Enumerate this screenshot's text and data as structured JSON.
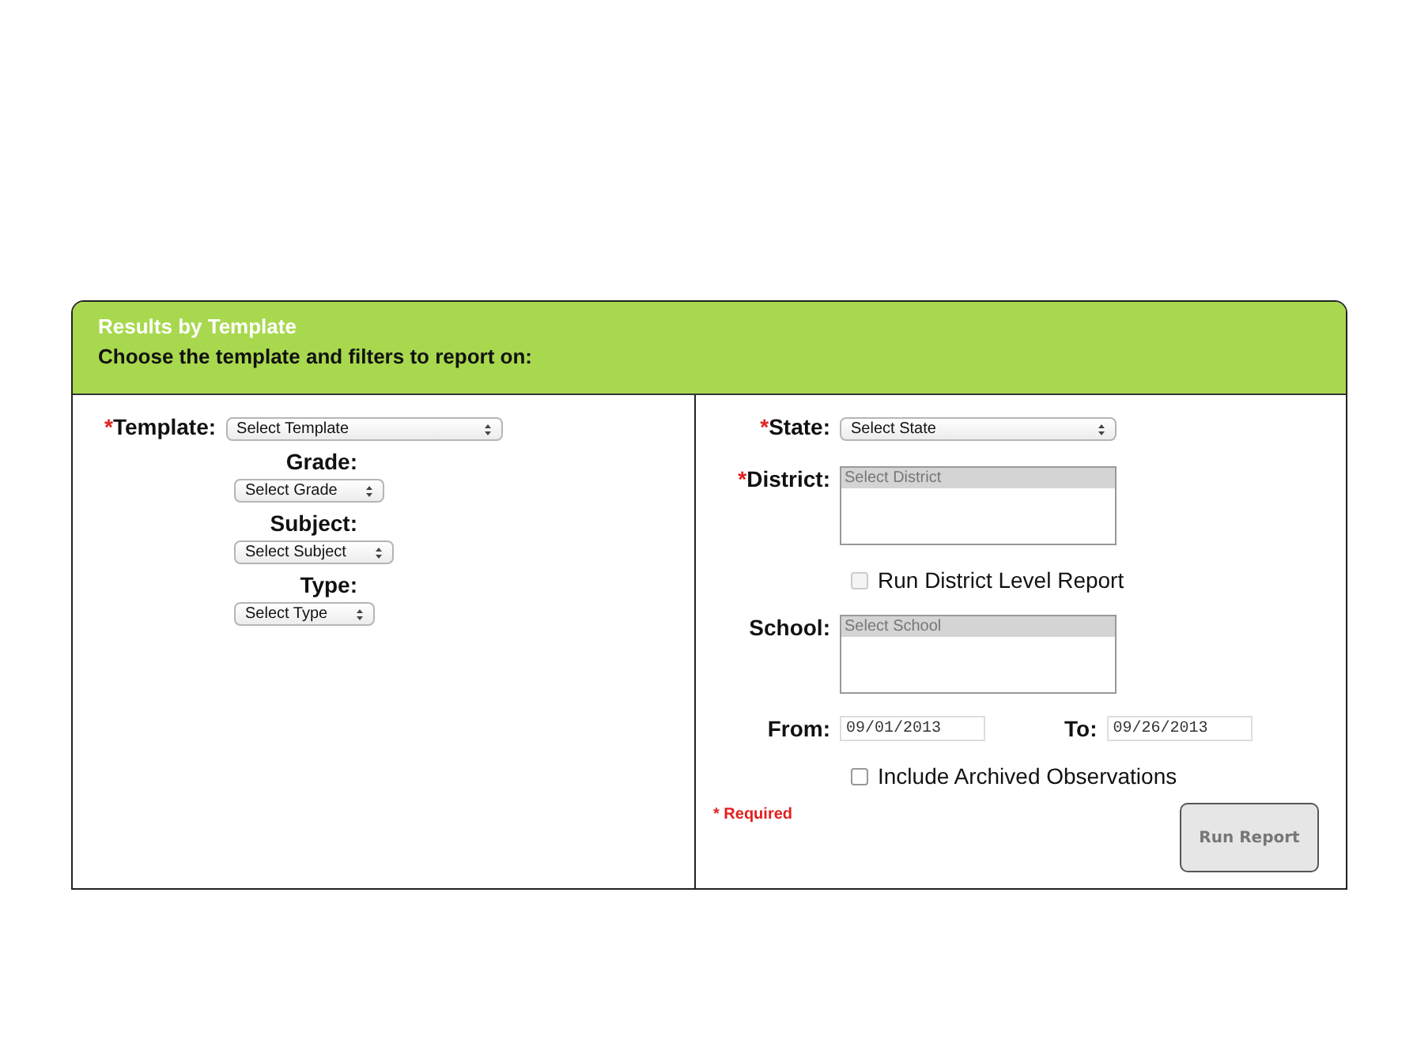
{
  "header": {
    "title": "Results by Template",
    "subtitle": "Choose the template and filters to report on:"
  },
  "left_fields": [
    {
      "kind": "inline",
      "required_mark": "*",
      "label": "Template:",
      "value": "Select Template"
    },
    {
      "kind": "stacked",
      "label": "Grade:",
      "value": "Select Grade"
    },
    {
      "kind": "stacked",
      "label": "Subject:",
      "value": "Select Subject"
    },
    {
      "kind": "stacked",
      "label": "Type:",
      "value": "Select Type"
    }
  ],
  "right_fields": [
    {
      "kind": "select",
      "required_mark": "*",
      "label": "State:",
      "value": "Select State"
    },
    {
      "kind": "listbox",
      "required_mark": "*",
      "label": "District:",
      "value": "Select District"
    },
    {
      "kind": "checkbox",
      "label": "Run District Level Report",
      "checked": false,
      "disabled": true
    },
    {
      "kind": "listbox",
      "label": "School:",
      "value": "Select School"
    },
    {
      "kind": "dates",
      "label": "From:",
      "value": "09/01/2013",
      "label_2": "To:",
      "value_2": "09/26/2013"
    },
    {
      "kind": "checkbox",
      "label": "Include Archived Observations",
      "checked": false,
      "disabled": false
    }
  ],
  "required_note": "* Required",
  "run_button": {
    "label": "Run Report",
    "disabled": true
  }
}
